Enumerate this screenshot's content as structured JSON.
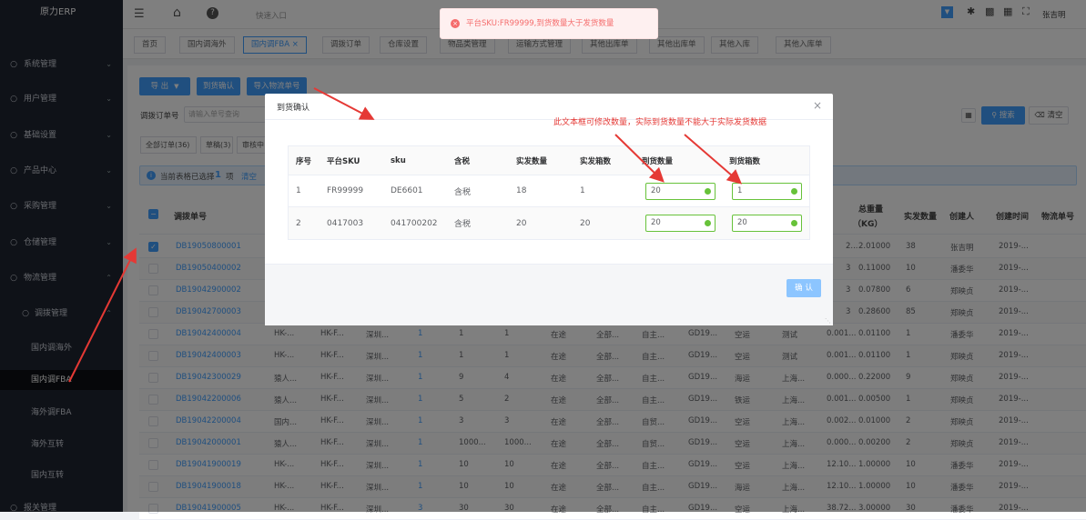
{
  "app": {
    "title": "原力ERP"
  },
  "sidebar": {
    "items": [
      {
        "label": "系统管理",
        "icon": "gear-icon"
      },
      {
        "label": "用户管理",
        "icon": "user-icon"
      },
      {
        "label": "基础设置",
        "icon": "settings-icon"
      },
      {
        "label": "产品中心",
        "icon": "box-icon"
      },
      {
        "label": "采购管理",
        "icon": "cart-icon"
      },
      {
        "label": "仓储管理",
        "icon": "warehouse-icon"
      },
      {
        "label": "物流管理",
        "icon": "truck-icon"
      }
    ],
    "sub_group": {
      "label": "调拨管理",
      "icon": "transfer-icon"
    },
    "sub_items": [
      "国内调海外",
      "国内调FBA",
      "海外调FBA",
      "海外互转",
      "国内互转"
    ],
    "last_item": {
      "label": "报关管理",
      "icon": "customs-icon"
    }
  },
  "topbar": {
    "quick_entry": "快速入口",
    "user": "张吉明"
  },
  "tabs": [
    "首页",
    "国内调海外",
    "国内调FBA",
    "调拨订单",
    "仓库设置",
    "物品类管理",
    "运输方式管理",
    "其他出库单",
    "其他出库单",
    "其他入库",
    "其他入库单"
  ],
  "toolbar": {
    "export": "导 出",
    "confirm_arrival": "到货确认",
    "import_logistics": "导入物流单号",
    "search_label": "调拨订单号",
    "search_placeholder": "请输入单号查询",
    "search_btn": "搜索",
    "clear_btn": "清空"
  },
  "filters": [
    "全部订单(36)",
    "草稿(3)",
    "审核中"
  ],
  "selection": {
    "text": "当前表格已选择",
    "count": "1",
    "unit": "项",
    "clear": "清空"
  },
  "table": {
    "headers": {
      "order_no": "调拨单号",
      "total_weight": "总重量",
      "weight_unit": "（KG）",
      "shipped_qty": "实发数量",
      "creator": "创建人",
      "created_at": "创建时间",
      "logistics_no": "物流单号"
    },
    "rows": [
      {
        "order_no": "DB19050800001",
        "c1": "",
        "c2": "",
        "c3": "",
        "c4": "",
        "c5": "",
        "c6": "",
        "c7": "",
        "c8": "",
        "c9": "",
        "c10": "",
        "c11": "",
        "c12": "",
        "c13": "",
        "c14": "2...",
        "weight": "2.01000",
        "qty": "38",
        "creator": "张吉明",
        "date": "2019-...",
        "checked": true
      },
      {
        "order_no": "DB19050400002",
        "c1": "",
        "c2": "",
        "c3": "",
        "c4": "",
        "c5": "",
        "c6": "",
        "c7": "",
        "c8": "",
        "c9": "",
        "c10": "",
        "c11": "",
        "c12": "",
        "c13": "",
        "c14": "3",
        "weight": "0.11000",
        "qty": "10",
        "creator": "潘委华",
        "date": "2019-...",
        "checked": false
      },
      {
        "order_no": "DB19042900002",
        "c1": "",
        "c2": "",
        "c3": "",
        "c4": "",
        "c5": "",
        "c6": "",
        "c7": "",
        "c8": "",
        "c9": "",
        "c10": "",
        "c11": "",
        "c12": "",
        "c13": "",
        "c14": "3",
        "weight": "0.07800",
        "qty": "6",
        "creator": "郑映贞",
        "date": "2019-...",
        "checked": false
      },
      {
        "order_no": "DB19042700003",
        "c1": "",
        "c2": "",
        "c3": "",
        "c4": "",
        "c5": "",
        "c6": "",
        "c7": "",
        "c8": "",
        "c9": "",
        "c10": "",
        "c11": "",
        "c12": "",
        "c13": "",
        "c14": "3",
        "weight": "0.28600",
        "qty": "85",
        "creator": "郑映贞",
        "date": "2019-...",
        "checked": false
      },
      {
        "order_no": "DB19042400004",
        "c1": "HK-...",
        "c2": "HK-F...",
        "c3": "深圳...",
        "c4": "1",
        "c5": "1",
        "c6": "1",
        "c7": "在途",
        "c8": "全部...",
        "c9": "自主...",
        "c10": "GD19...",
        "c11": "空运",
        "c12": "测试",
        "c13": "0.001...",
        "c14": "",
        "weight": "0.01100",
        "qty": "1",
        "creator": "潘委华",
        "date": "2019-...",
        "checked": false
      },
      {
        "order_no": "DB19042400003",
        "c1": "HK-...",
        "c2": "HK-F...",
        "c3": "深圳...",
        "c4": "1",
        "c5": "1",
        "c6": "1",
        "c7": "在途",
        "c8": "全部...",
        "c9": "自主...",
        "c10": "GD19...",
        "c11": "空运",
        "c12": "测试",
        "c13": "0.001...",
        "c14": "",
        "weight": "0.01100",
        "qty": "1",
        "creator": "郑映贞",
        "date": "2019-...",
        "checked": false
      },
      {
        "order_no": "DB19042300029",
        "c1": "猿人...",
        "c2": "HK-F...",
        "c3": "深圳...",
        "c4": "1",
        "c5": "9",
        "c6": "4",
        "c7": "在途",
        "c8": "全部...",
        "c9": "自主...",
        "c10": "GD19...",
        "c11": "海运",
        "c12": "上海...",
        "c13": "0.000...",
        "c14": "",
        "weight": "0.22000",
        "qty": "9",
        "creator": "郑映贞",
        "date": "2019-...",
        "checked": false
      },
      {
        "order_no": "DB19042200006",
        "c1": "猿人...",
        "c2": "HK-F...",
        "c3": "深圳...",
        "c4": "1",
        "c5": "5",
        "c6": "2",
        "c7": "在途",
        "c8": "全部...",
        "c9": "自主...",
        "c10": "GD19...",
        "c11": "铁运",
        "c12": "上海...",
        "c13": "0.001...",
        "c14": "",
        "weight": "0.00500",
        "qty": "1",
        "creator": "郑映贞",
        "date": "2019-...",
        "checked": false
      },
      {
        "order_no": "DB19042200004",
        "c1": "国内...",
        "c2": "HK-F...",
        "c3": "深圳...",
        "c4": "1",
        "c5": "3",
        "c6": "3",
        "c7": "在途",
        "c8": "全部...",
        "c9": "自贸...",
        "c10": "GD19...",
        "c11": "空运",
        "c12": "上海...",
        "c13": "0.002...",
        "c14": "",
        "weight": "0.01000",
        "qty": "2",
        "creator": "郑映贞",
        "date": "2019-...",
        "checked": false
      },
      {
        "order_no": "DB19042000001",
        "c1": "猿人...",
        "c2": "HK-F...",
        "c3": "深圳...",
        "c4": "1",
        "c5": "1000...",
        "c6": "1000...",
        "c7": "在途",
        "c8": "全部...",
        "c9": "自贸...",
        "c10": "GD19...",
        "c11": "空运",
        "c12": "上海...",
        "c13": "0.000...",
        "c14": "",
        "weight": "0.00200",
        "qty": "2",
        "creator": "郑映贞",
        "date": "2019-...",
        "checked": false
      },
      {
        "order_no": "DB19041900019",
        "c1": "HK-...",
        "c2": "HK-F...",
        "c3": "深圳...",
        "c4": "1",
        "c5": "10",
        "c6": "10",
        "c7": "在途",
        "c8": "全部...",
        "c9": "自主...",
        "c10": "GD19...",
        "c11": "空运",
        "c12": "上海...",
        "c13": "12.10...",
        "c14": "",
        "weight": "1.00000",
        "qty": "10",
        "creator": "潘委华",
        "date": "2019-...",
        "checked": false
      },
      {
        "order_no": "DB19041900018",
        "c1": "HK-...",
        "c2": "HK-F...",
        "c3": "深圳...",
        "c4": "1",
        "c5": "10",
        "c6": "10",
        "c7": "在途",
        "c8": "全部...",
        "c9": "自主...",
        "c10": "GD19...",
        "c11": "海运",
        "c12": "上海...",
        "c13": "12.10...",
        "c14": "",
        "weight": "1.00000",
        "qty": "10",
        "creator": "潘委华",
        "date": "2019-...",
        "checked": false
      },
      {
        "order_no": "DB19041900005",
        "c1": "HK-...",
        "c2": "HK-F...",
        "c3": "深圳...",
        "c4": "3",
        "c5": "30",
        "c6": "30",
        "c7": "在途",
        "c8": "全部...",
        "c9": "自主...",
        "c10": "GD19...",
        "c11": "空运",
        "c12": "上海...",
        "c13": "38.72...",
        "c14": "",
        "weight": "3.00000",
        "qty": "30",
        "creator": "潘委华",
        "date": "2019-...",
        "checked": false
      }
    ]
  },
  "modal": {
    "title": "到货确认",
    "headers": [
      "序号",
      "平台SKU",
      "sku",
      "含税",
      "实发数量",
      "实发箱数",
      "到货数量",
      "到货箱数"
    ],
    "rows": [
      {
        "no": "1",
        "platform_sku": "FR99999",
        "sku": "DE6601",
        "tax": "含税",
        "shipped_qty": "18",
        "shipped_boxes": "1",
        "arrived_qty": "20",
        "arrived_boxes": "1"
      },
      {
        "no": "2",
        "platform_sku": "0417003",
        "sku": "041700202",
        "tax": "含税",
        "shipped_qty": "20",
        "shipped_boxes": "20",
        "arrived_qty": "20",
        "arrived_boxes": "20"
      }
    ],
    "confirm": "确 认"
  },
  "toast": {
    "message": "平台SKU:FR99999,到货数量大于发货数量"
  },
  "annotation": {
    "text": "此文本框可修改数量，实际到货数量不能大于实际发货数据",
    "color": "#e53935"
  }
}
